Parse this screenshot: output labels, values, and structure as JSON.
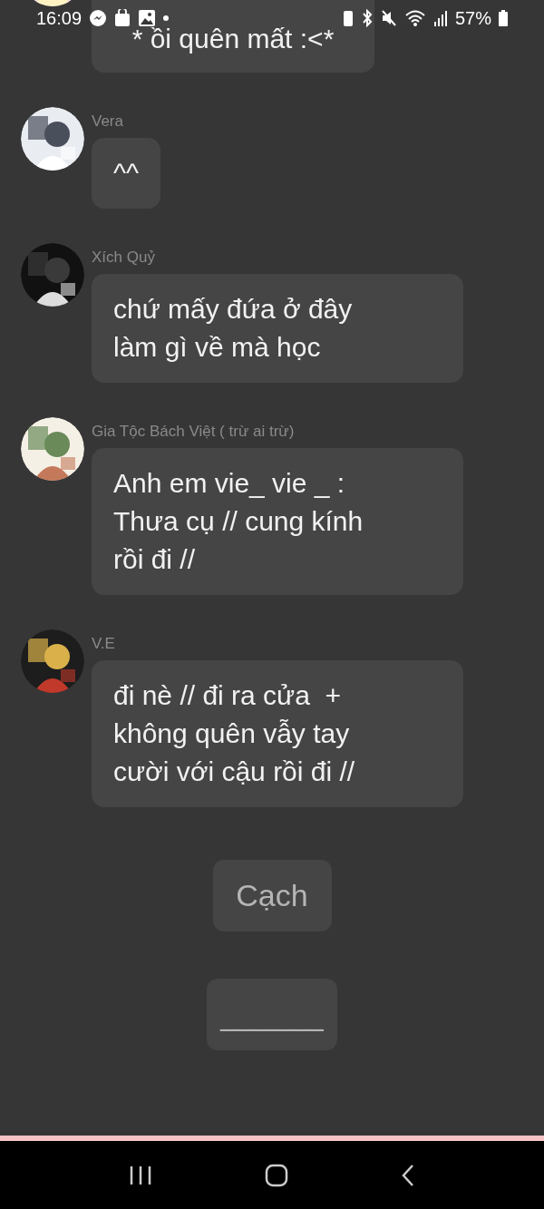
{
  "status_bar": {
    "time": "16:09",
    "battery": "57%"
  },
  "top_message": {
    "lines": [
      "* ồi quên mất :<*"
    ]
  },
  "messages": [
    {
      "sender": "Vera",
      "lines": [
        "^^"
      ]
    },
    {
      "sender": "Xích Quỷ",
      "lines": [
        "chứ mấy đứa ở đây",
        "làm gì về mà học"
      ]
    },
    {
      "sender": "Gia Tộc Bách Việt ( trừ ai trừ)",
      "lines": [
        "Anh em vie_ vie _ :",
        "Thưa cụ // cung kính",
        "rồi đi //"
      ]
    },
    {
      "sender": "V.E",
      "lines": [
        "đi nè // đi ra cửa  +",
        "không quên vẫy tay",
        "cười với cậu rồi đi //"
      ]
    }
  ],
  "narration": [
    "Cạch",
    "______"
  ]
}
